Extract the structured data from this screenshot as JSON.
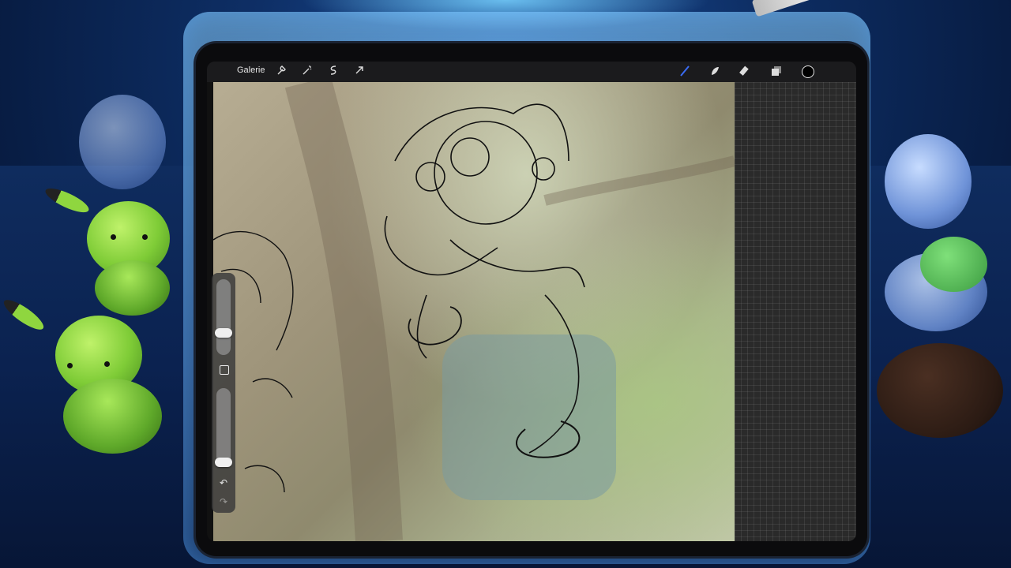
{
  "toolbar": {
    "gallery_label": "Galerie",
    "left_icons": [
      "wrench-icon",
      "magic-wand-icon",
      "selection-icon",
      "transform-arrow-icon"
    ],
    "right_icons": [
      "brush-icon",
      "smudge-icon",
      "eraser-icon",
      "layers-icon",
      "color-picker-icon"
    ],
    "active_tool": "brush"
  },
  "sidebar": {
    "brush_size": 0.26,
    "brush_opacity": 0.0,
    "undo_label": "↶",
    "redo_label": "↷"
  },
  "colors": {
    "accent": "#3a6cf4",
    "ui_dark": "#1b1b1d",
    "current_color": "#000000"
  }
}
